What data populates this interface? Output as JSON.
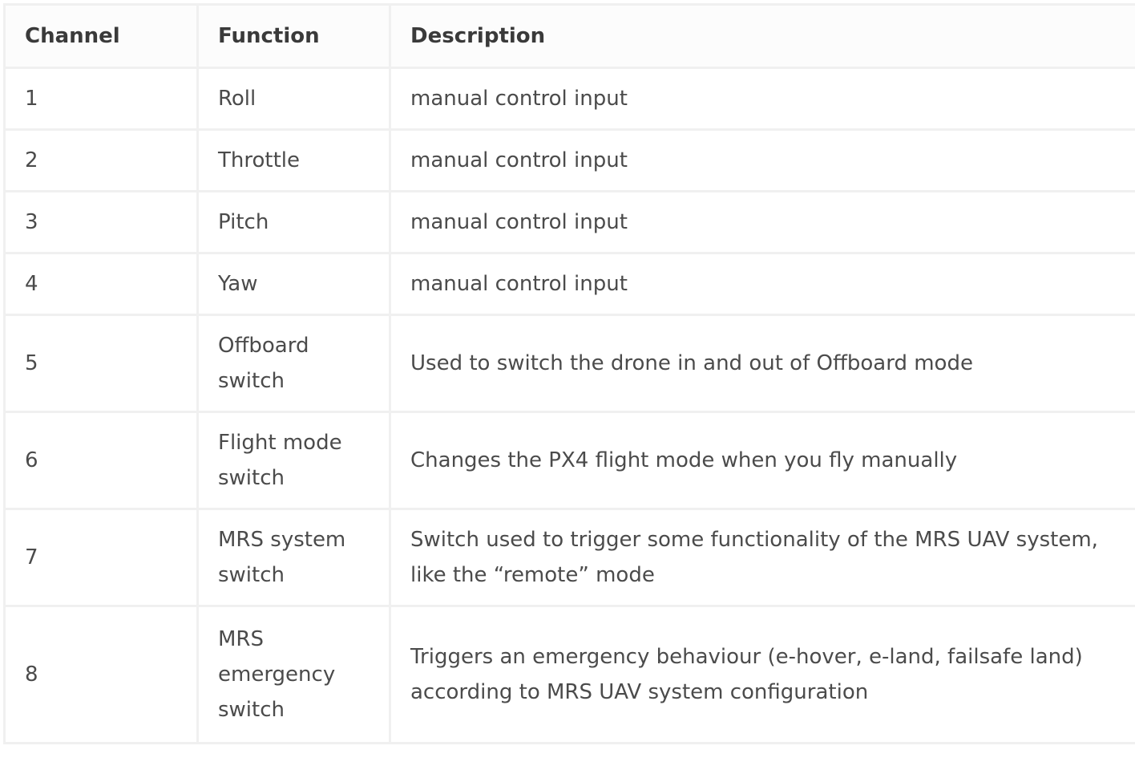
{
  "table": {
    "headers": [
      "Channel",
      "Function",
      "Description"
    ],
    "rows": [
      {
        "channel": "1",
        "function": "Roll",
        "description": "manual control input"
      },
      {
        "channel": "2",
        "function": "Throttle",
        "description": "manual control input"
      },
      {
        "channel": "3",
        "function": "Pitch",
        "description": "manual control input"
      },
      {
        "channel": "4",
        "function": "Yaw",
        "description": "manual control input"
      },
      {
        "channel": "5",
        "function": "Offboard switch",
        "description": "Used to switch the drone in and out of Offboard mode"
      },
      {
        "channel": "6",
        "function": "Flight mode switch",
        "description": "Changes the PX4 flight mode when you fly manually"
      },
      {
        "channel": "7",
        "function": "MRS system switch",
        "description": "Switch used to trigger some functionality of the MRS UAV system, like the “remote” mode"
      },
      {
        "channel": "8",
        "function": "MRS emergency switch",
        "description": "Triggers an emergency behaviour (e-hover, e-land, failsafe land) according to MRS UAV system configuration"
      }
    ]
  }
}
